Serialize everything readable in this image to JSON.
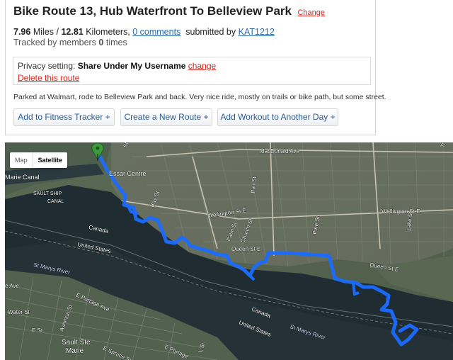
{
  "route": {
    "title": "Bike Route 13, Hub Waterfront To Belleview Park",
    "change_label": "Change",
    "miles": "7.96",
    "miles_unit": "Miles /",
    "km": "12.81",
    "km_unit": "Kilometers,",
    "comments_link": "0 comments",
    "submitted_by_label": "submitted by",
    "submitter": "KAT1212",
    "tracked_prefix": "Tracked by members",
    "tracked_count": "0",
    "tracked_suffix": "times"
  },
  "privacy": {
    "label": "Privacy setting:",
    "value": "Share Under My Username",
    "change_label": "change",
    "delete_label": "Delete this route"
  },
  "description": "Parked at Walmart, rode to Belleview Park and back. Very nice ride, mostly on trails or bike path, but some street.",
  "buttons": {
    "fitness": "Add to Fitness Tracker +",
    "new_route": "Create a New Route +",
    "workout": "Add Workout to Another Day +"
  },
  "map": {
    "toggle_map": "Map",
    "toggle_satellite": "Satellite",
    "route_color": "#1a6cff",
    "labels": {
      "macdonald": "MacDonald Ave",
      "tru": "Tru",
      "essar": "Essar Centre",
      "marie_canal": "Marie Canal",
      "soo_canal_1": "SAULT SHIP",
      "soo_canal_2": "CANAL",
      "bay": "Bay St",
      "wellington_w": "Wellington St E",
      "wellington_e": "Wellington St E",
      "palm": "Palm St",
      "church": "Church St",
      "pim": "Pim St",
      "queen_w": "Queen St E",
      "queen_e": "Queen St E",
      "pine": "Pine St",
      "lake": "Lake St",
      "canada_1": "Canada",
      "us_1": "United States",
      "stmarys_1": "St Marys River",
      "canada_2": "Canada",
      "us_2": "United States",
      "stmarys_2": "St Marys River",
      "ave": "e Ave",
      "portage": "E Portage Ave",
      "water_st": "Water St",
      "ashmun": "Ashmun St",
      "e_st": "E St",
      "sault1": "Sault Ste.",
      "sault2": "Marie",
      "spruce": "E Spruce St",
      "portage2": "E Portage",
      "lst": "L St",
      "st_tag": "St"
    }
  }
}
